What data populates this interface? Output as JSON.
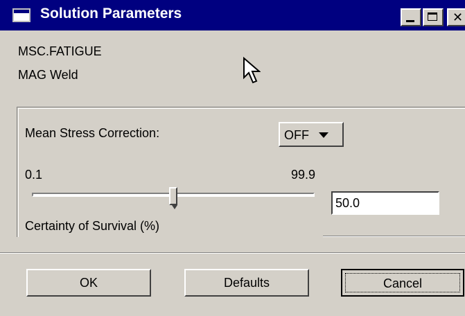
{
  "window": {
    "title": "Solution Parameters",
    "controls": {
      "minimize_icon": "minimize-icon",
      "maximize_icon": "maximize-icon",
      "close_icon": "close-icon",
      "close_glyph": "✕"
    }
  },
  "info": {
    "line1": "MSC.FATIGUE",
    "line2": "MAG Weld"
  },
  "mean_stress": {
    "label": "Mean Stress Correction:",
    "value": "OFF"
  },
  "survival": {
    "min_label": "0.1",
    "max_label": "99.9",
    "value": "50.0",
    "slider_fraction": 0.5,
    "label": "Certainty of Survival (%)"
  },
  "buttons": {
    "ok": "OK",
    "defaults": "Defaults",
    "cancel": "Cancel"
  },
  "colors": {
    "titlebar": "#000080",
    "face": "#d4d0c8"
  }
}
